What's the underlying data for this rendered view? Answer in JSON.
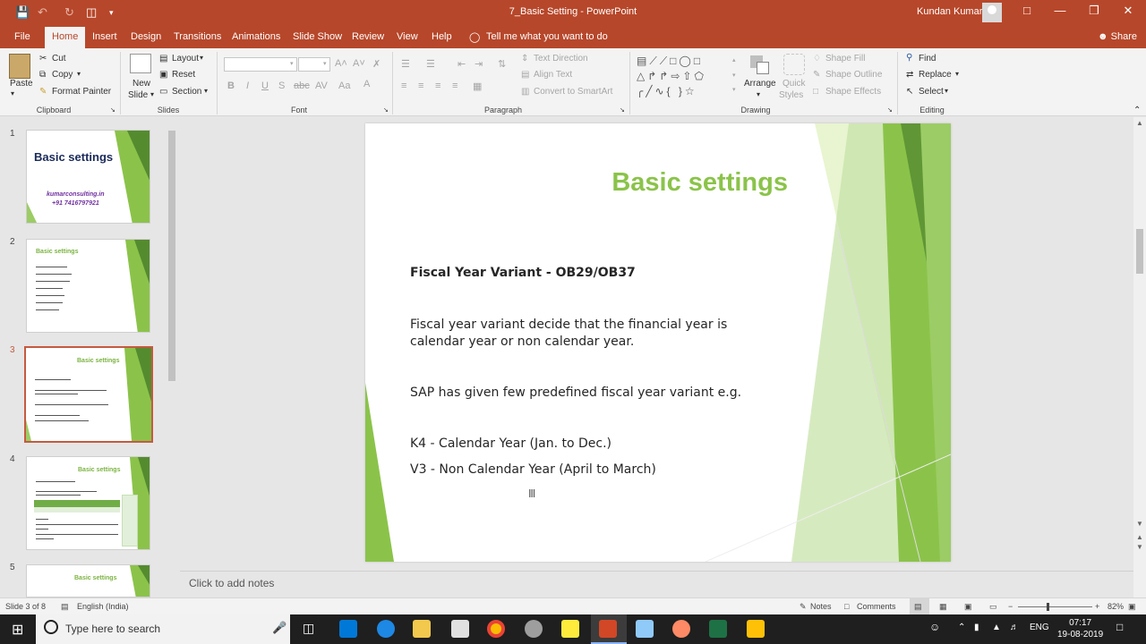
{
  "window": {
    "title": "7_Basic Setting  -  PowerPoint",
    "user": "Kundan Kumar"
  },
  "tabs": [
    "File",
    "Home",
    "Insert",
    "Design",
    "Transitions",
    "Animations",
    "Slide Show",
    "Review",
    "View",
    "Help"
  ],
  "active_tab": "Home",
  "tell_me": "Tell me what you want to do",
  "share": "Share",
  "ribbon": {
    "clipboard": {
      "paste": "Paste",
      "cut": "Cut",
      "copy": "Copy",
      "format_painter": "Format Painter",
      "label": "Clipboard"
    },
    "slides": {
      "new_slide": "New",
      "new_slide2": "Slide",
      "layout": "Layout",
      "reset": "Reset",
      "section": "Section",
      "label": "Slides"
    },
    "font": {
      "label": "Font"
    },
    "paragraph": {
      "text_direction": "Text Direction",
      "align_text": "Align Text",
      "convert_smartart": "Convert to SmartArt",
      "label": "Paragraph"
    },
    "drawing": {
      "arrange": "Arrange",
      "quick_styles": "Quick",
      "quick_styles2": "Styles",
      "shape_fill": "Shape Fill",
      "shape_outline": "Shape Outline",
      "shape_effects": "Shape Effects",
      "label": "Drawing"
    },
    "editing": {
      "find": "Find",
      "replace": "Replace",
      "select": "Select",
      "label": "Editing"
    }
  },
  "thumbnails": [
    {
      "num": "1",
      "title": "Basic settings",
      "line1": "kumarconsulting.in",
      "line2": "+91 7416797921"
    },
    {
      "num": "2",
      "title": "Basic settings"
    },
    {
      "num": "3",
      "title": "Basic settings"
    },
    {
      "num": "4",
      "title": "Basic settings"
    },
    {
      "num": "5",
      "title": "Basic settings"
    }
  ],
  "slide": {
    "title": "Basic settings",
    "heading": "Fiscal Year Variant - OB29/OB37",
    "para1_line1": "Fiscal year variant decide that the financial year is",
    "para1_line2": "calendar year or non calendar year.",
    "para2": "SAP has given few predefined fiscal year variant e.g.",
    "item1": "K4 - Calendar Year (Jan. to Dec.)",
    "item2": "V3 - Non Calendar Year (April to March)"
  },
  "notes_placeholder": "Click to add notes",
  "status": {
    "slide_info": "Slide 3 of 8",
    "language": "English (India)",
    "notes": "Notes",
    "comments": "Comments",
    "zoom": "82%"
  },
  "taskbar": {
    "search_placeholder": "Type here to search",
    "lang": "ENG",
    "time": "07:17",
    "date": "19-08-2019"
  },
  "colors": {
    "accent": "#b7472a",
    "slide_title": "#8bc34a",
    "taskbar": "#1f1f1f"
  }
}
